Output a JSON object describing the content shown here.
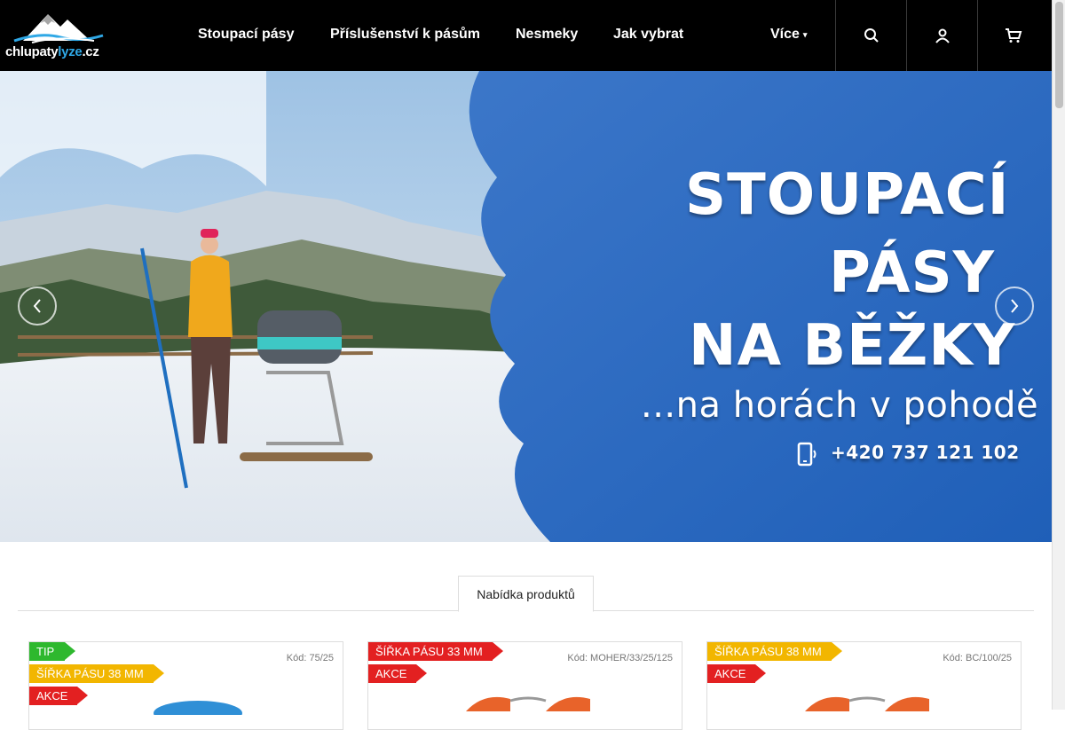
{
  "header": {
    "logo": {
      "text_main": "chlupaty",
      "text_accent": "lyze",
      "text_tld": ".cz"
    },
    "nav": [
      {
        "label": "Stoupací pásy"
      },
      {
        "label": "Příslušenství k pásům"
      },
      {
        "label": "Nesmeky"
      },
      {
        "label": "Jak vybrat"
      }
    ],
    "more_label": "Více",
    "icons": [
      "search-icon",
      "user-icon",
      "cart-icon"
    ]
  },
  "hero": {
    "title_line1": "STOUPACÍ",
    "title_line2": "PÁSY",
    "title_line3": "NA BĚŽKY",
    "subtitle": "...na horách v pohodě",
    "phone": "+420 737 121 102"
  },
  "tabs": [
    {
      "label": "Nabídka produktů"
    }
  ],
  "products": [
    {
      "code": "Kód: 75/25",
      "flags": [
        {
          "label": "TIP",
          "color": "#2eb82e"
        },
        {
          "label": "ŠÍŘKA PÁSU 38 MM",
          "color": "#f2b600"
        },
        {
          "label": "AKCE",
          "color": "#e32021"
        }
      ]
    },
    {
      "code": "Kód: MOHER/33/25/125",
      "flags": [
        {
          "label": "ŠÍŘKA PÁSU 33 MM",
          "color": "#e32021"
        },
        {
          "label": "AKCE",
          "color": "#e32021"
        }
      ]
    },
    {
      "code": "Kód: BC/100/25",
      "flags": [
        {
          "label": "ŠÍŘKA PÁSU 38 MM",
          "color": "#f2b600"
        },
        {
          "label": "AKCE",
          "color": "#e32021"
        }
      ]
    }
  ],
  "colors": {
    "header_bg": "#000000",
    "accent_blue": "#2fa8e6",
    "flag_green": "#2eb82e",
    "flag_yellow": "#f2b600",
    "flag_red": "#e32021"
  }
}
